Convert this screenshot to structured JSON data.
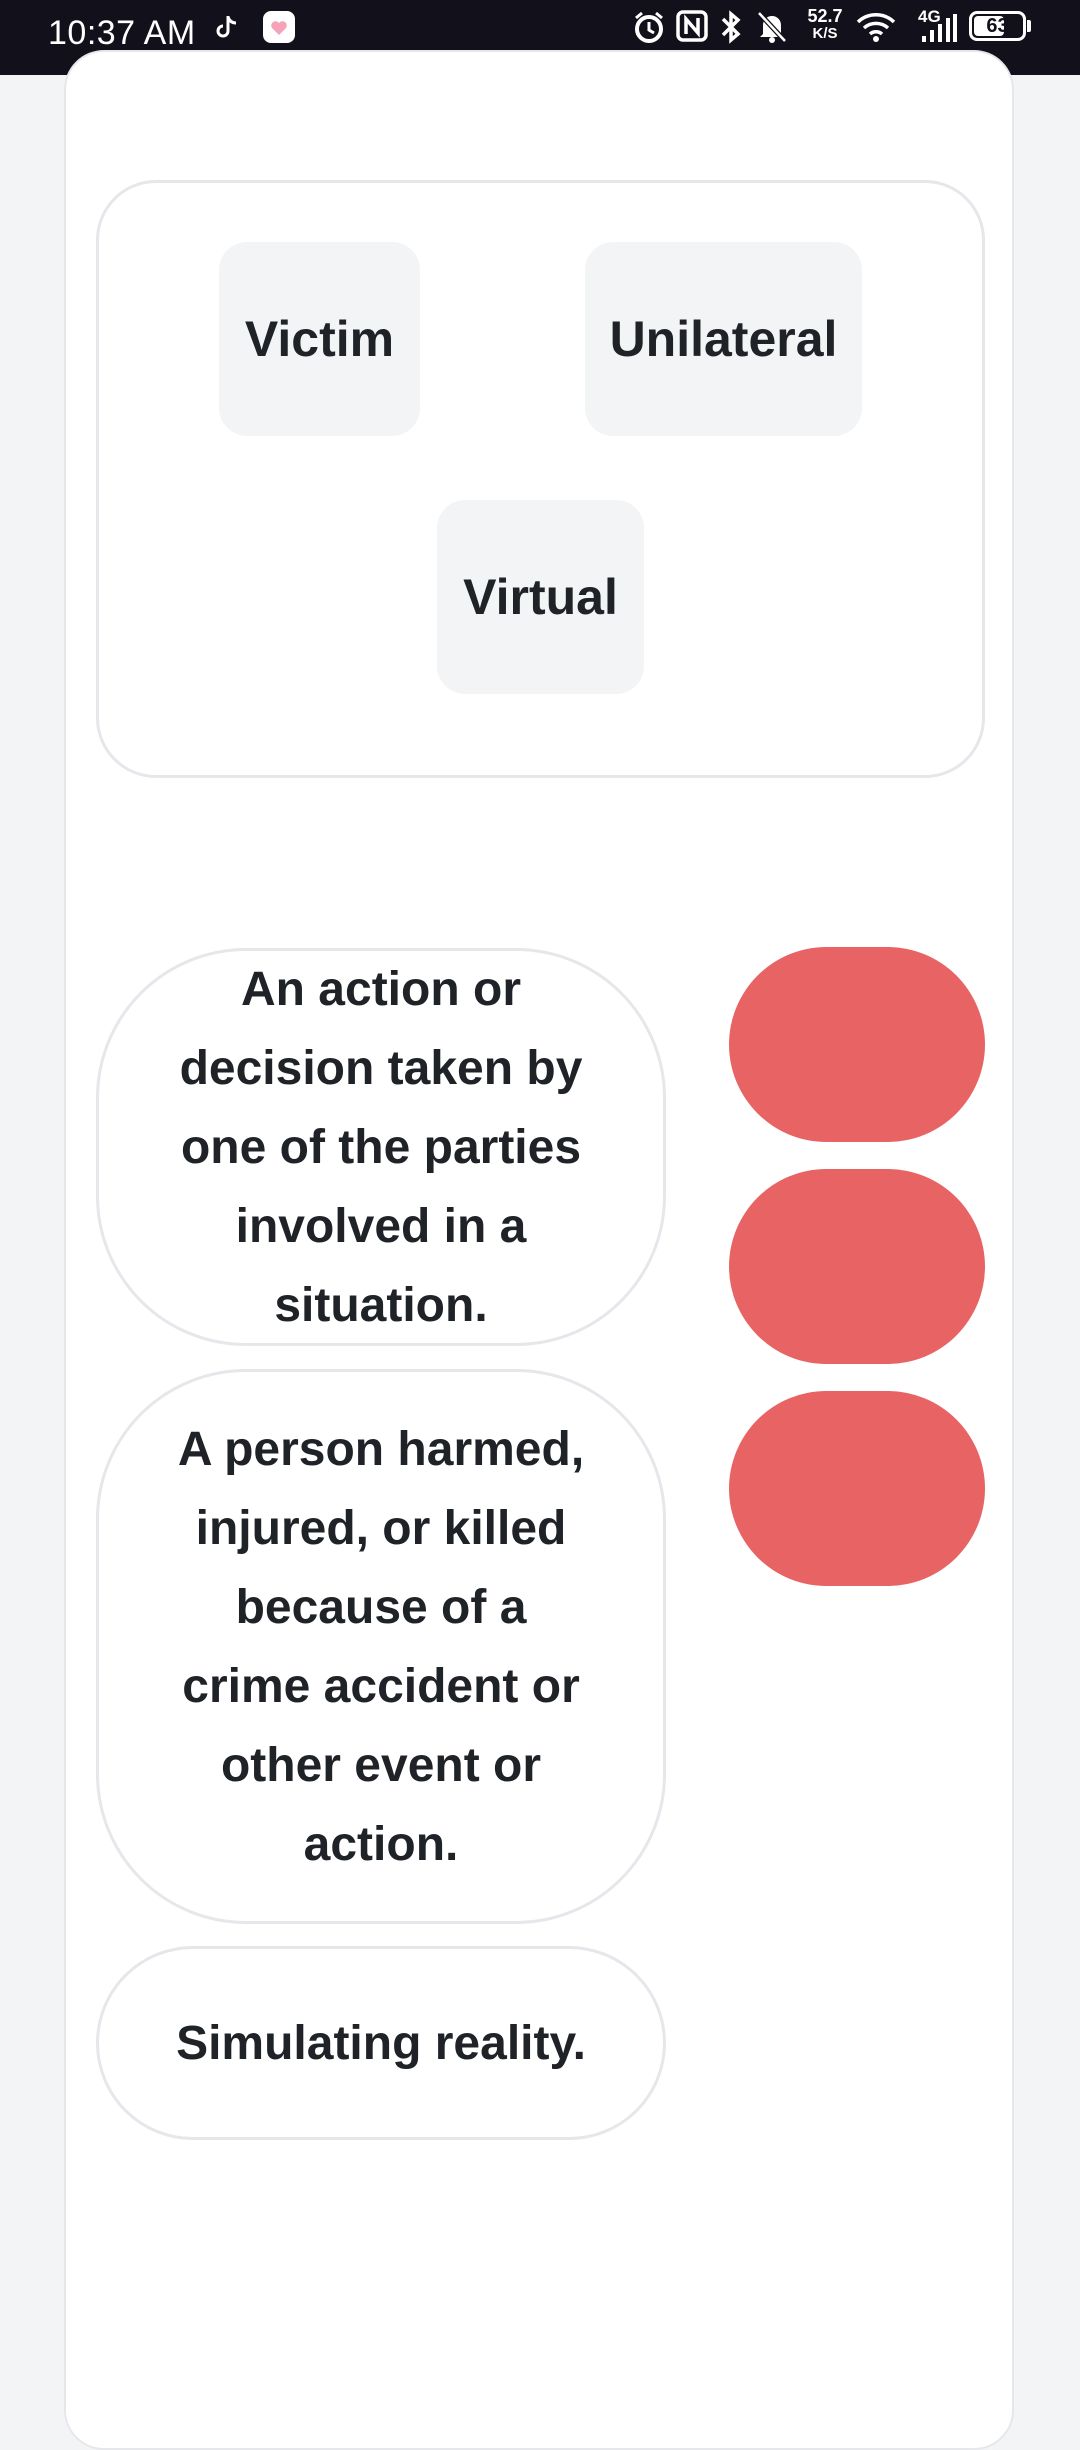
{
  "status_bar": {
    "time": "10:37 AM",
    "net_speed_value": "52.7",
    "net_speed_unit": "K/S",
    "network_type": "4G",
    "battery": "63",
    "battery_level": 0.63
  },
  "word_bank": {
    "words": [
      "Victim",
      "Unilateral",
      "Virtual"
    ]
  },
  "definitions": [
    "An action or decision taken by one of the parties involved in a situation.",
    "A person harmed, injured, or killed because of a crime accident or other event or action.",
    "Simulating reality."
  ],
  "colors": {
    "slot_empty": "#e86464",
    "chip_bg": "#f3f4f6",
    "border": "#e5e7eb",
    "status_bar_bg": "#12111b"
  }
}
